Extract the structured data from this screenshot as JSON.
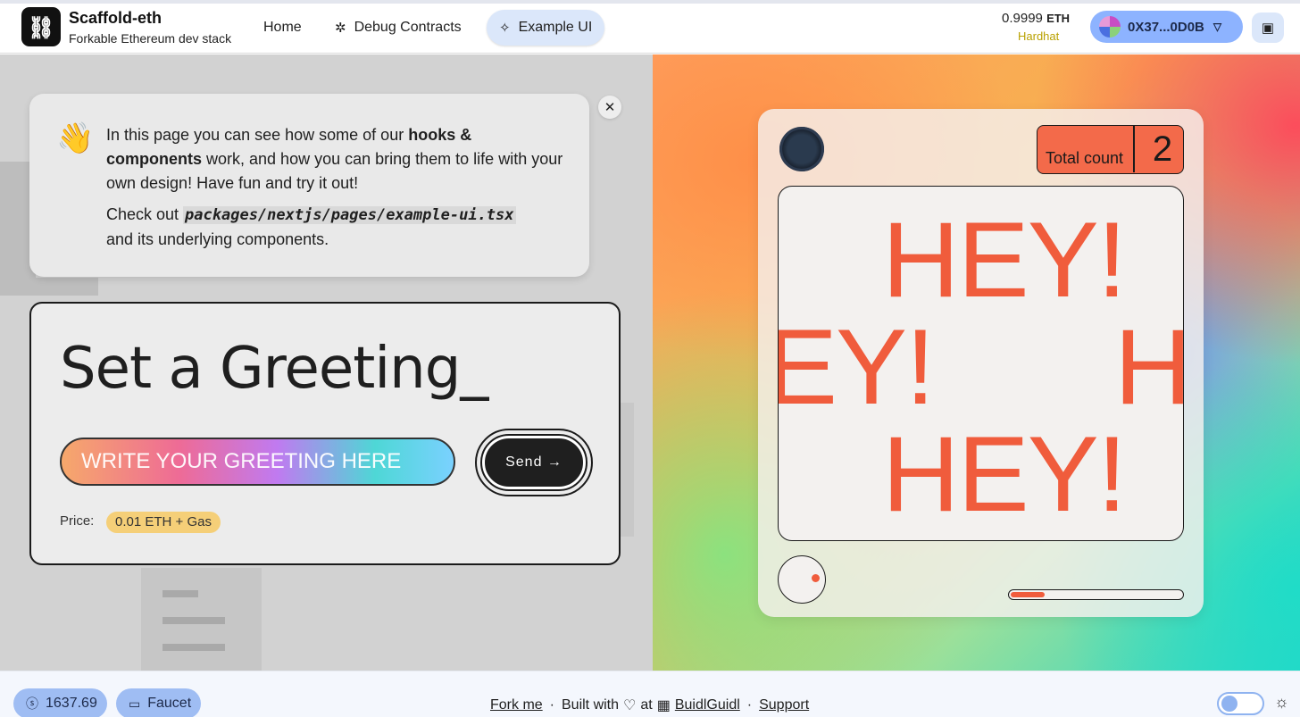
{
  "header": {
    "logo_glyph": "⛓",
    "brand_title": "Scaffold-eth",
    "brand_subtitle": "Forkable Ethereum dev stack",
    "nav": [
      {
        "label": "Home",
        "icon": ""
      },
      {
        "label": "Debug Contracts",
        "icon": "bug-icon"
      },
      {
        "label": "Example UI",
        "icon": "sparkles-icon",
        "active": true
      }
    ],
    "balance_value": "0.9999",
    "balance_unit": "ETH",
    "network": "Hardhat",
    "address": "0X37...0D0B",
    "accent": "#8db3ff"
  },
  "alert": {
    "text_before_bold": "In this page you can see how some of our ",
    "bold": "hooks & components",
    "text_after_bold": " work, and how you can bring them to life with your own design! Have fun and try it out!",
    "check_out": "Check out ",
    "path": "packages/nextjs/pages/example-ui.tsx",
    "after_path": " and its underlying components."
  },
  "greeting_card": {
    "title": "Set a Greeting_",
    "input_placeholder": "WRITE YOUR GREETING HERE",
    "send_label": "Send →",
    "price_label": "Price:",
    "price_value": "0.01 ETH + Gas"
  },
  "display_card": {
    "count_label": "Total count",
    "count_value": "2",
    "hey_1": "HEY!",
    "hey_2": "EY!",
    "hey_2b": "H",
    "hey_3": "HEY!",
    "progress_fraction": 0.2,
    "accent": "#f05c3c"
  },
  "footer": {
    "price": "1637.69",
    "faucet": "Faucet",
    "fork_me": "Fork me",
    "built_with": "Built with",
    "at": "at",
    "buidlguidl": "BuidlGuidl",
    "support": "Support",
    "dot": "·"
  }
}
